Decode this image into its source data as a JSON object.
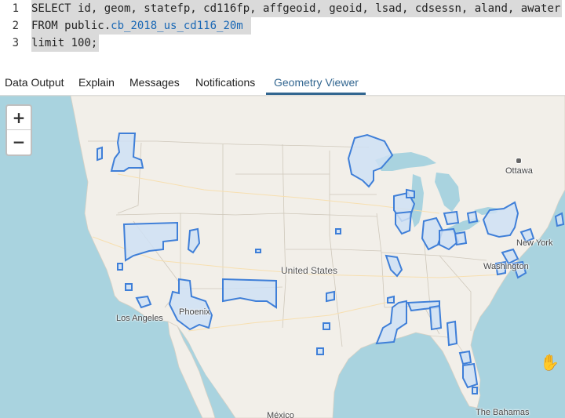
{
  "editor": {
    "lines": [
      {
        "num": "1",
        "text": "SELECT id, geom, statefp, cd116fp, affgeoid, geoid, lsad, cdsessn, aland, awater"
      },
      {
        "num": "2",
        "prefix": "FROM public.",
        "table": "cb_2018_us_cd116_20m"
      },
      {
        "num": "3",
        "text": "limit 100;"
      }
    ]
  },
  "tabs": [
    {
      "label": "Data Output"
    },
    {
      "label": "Explain"
    },
    {
      "label": "Messages"
    },
    {
      "label": "Notifications"
    },
    {
      "label": "Geometry Viewer",
      "active": true
    }
  ],
  "map": {
    "zoom_in": "+",
    "zoom_out": "−",
    "labels": {
      "ottawa": "Ottawa",
      "new_york": "New York",
      "washington": "Washington",
      "united_states": "United States",
      "los_angeles": "Los Angeles",
      "phoenix": "Phoenix",
      "mexico": "México",
      "bahamas": "The Bahamas"
    },
    "colors": {
      "land": "#f2efe9",
      "water": "#a9d3df",
      "district_fill": "#cfe0f5",
      "district_stroke": "#3f7fd8",
      "active_tab": "#326690"
    }
  }
}
